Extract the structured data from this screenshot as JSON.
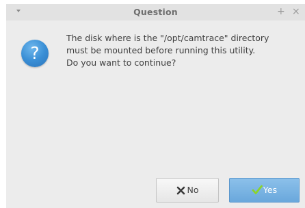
{
  "window": {
    "title": "Question",
    "menu_icon": "chevron-down-icon",
    "maximize_icon": "plus-icon",
    "close_icon": "close-icon",
    "maximize_glyph": "+",
    "close_glyph": "×"
  },
  "dialog": {
    "icon": "question-icon",
    "icon_glyph": "?",
    "message_lines": [
      "The disk where is the \"/opt/camtrace\" directory",
      "must be mounted before running this utility.",
      "Do you want to continue?"
    ]
  },
  "buttons": {
    "no": {
      "label": "No",
      "icon": "x-icon"
    },
    "yes": {
      "label": "Yes",
      "icon": "checkmark-icon"
    }
  },
  "colors": {
    "background": "#ececec",
    "titlebar": "#e2e2e2",
    "accent": "#6aa8dc",
    "question_icon": "#3a8fd6",
    "checkmark": "#8bd42a"
  }
}
